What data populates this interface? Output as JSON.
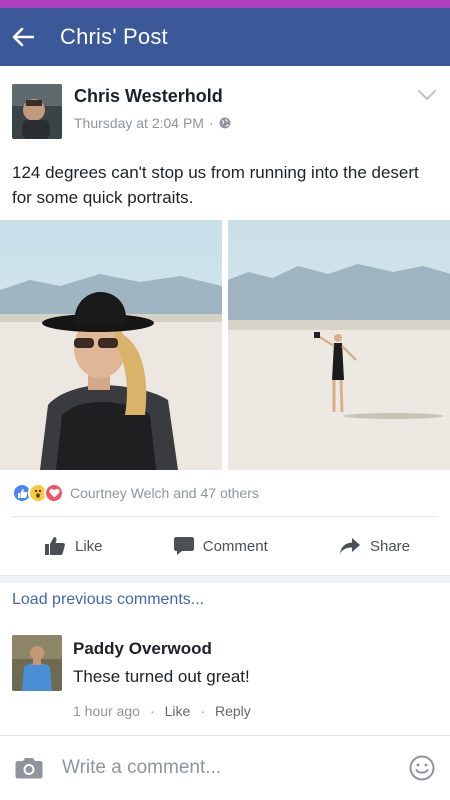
{
  "app_bar": {
    "title": "Chris' Post",
    "back_icon": "back-arrow-icon"
  },
  "post": {
    "author": "Chris Westerhold",
    "timestamp": "Thursday at 2:04 PM",
    "separator": "·",
    "privacy_icon": "globe-icon",
    "text": "124 degrees can't stop us from running into the desert for some quick portraits.",
    "photos": [
      "portrait-photo",
      "desert-photo"
    ]
  },
  "reactions": {
    "icons": [
      "like-reaction-icon",
      "wow-reaction-icon",
      "love-reaction-icon"
    ],
    "summary": "Courtney Welch and 47 others"
  },
  "actions": {
    "like": "Like",
    "comment": "Comment",
    "share": "Share"
  },
  "comments": {
    "load_previous": "Load previous comments...",
    "items": [
      {
        "author": "Paddy Overwood",
        "text": "These turned out great!",
        "time": "1 hour ago",
        "sep": "·",
        "like": "Like",
        "reply": "Reply"
      }
    ]
  },
  "composer": {
    "placeholder": "Write a comment..."
  },
  "colors": {
    "status_strip": "#b13dbf",
    "app_bar": "#3b5998",
    "link": "#4267b2",
    "muted": "#90949c"
  }
}
